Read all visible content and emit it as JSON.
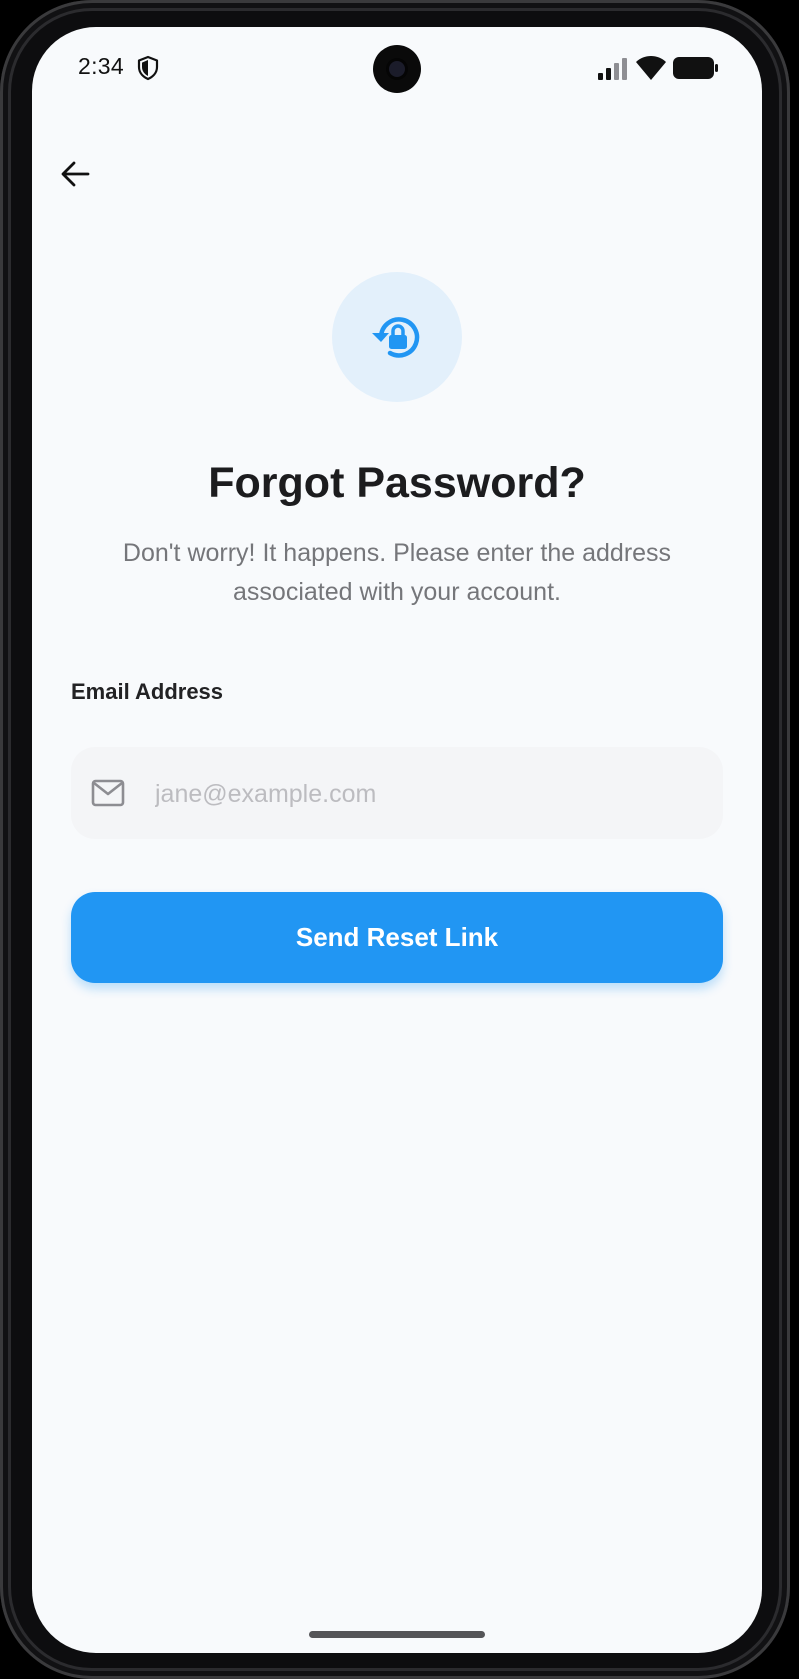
{
  "status_bar": {
    "time": "2:34",
    "icons": [
      "shield-icon",
      "signal-icon",
      "wifi-icon",
      "battery-icon"
    ]
  },
  "nav": {
    "back_icon": "arrow-left-icon"
  },
  "hero": {
    "icon": "lock-reset-icon"
  },
  "page": {
    "title": "Forgot Password?",
    "subtitle": "Don't worry! It happens. Please enter the address associated with your account."
  },
  "form": {
    "email_label": "Email Address",
    "email_placeholder": "jane@example.com",
    "email_value": "",
    "email_icon": "mail-icon",
    "submit_label": "Send Reset Link"
  },
  "colors": {
    "primary": "#2196f3",
    "background": "#f8fafc",
    "hero_circle": "#e3f0fb",
    "title_text": "#1c1c1e",
    "muted_text": "#75767a",
    "input_fill": "#f4f5f7"
  }
}
